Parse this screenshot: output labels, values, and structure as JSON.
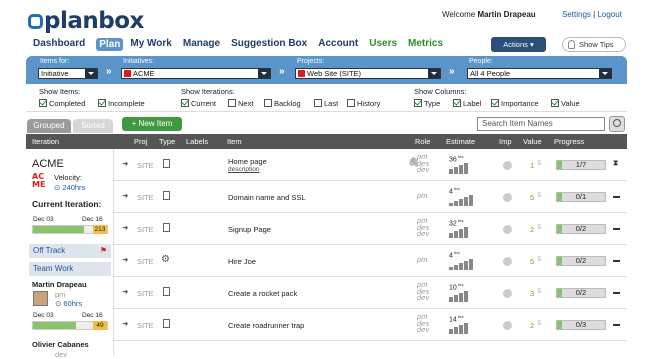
{
  "header": {
    "logo": "planbox",
    "welcome_prefix": "Welcome",
    "user_name": "Martin Drapeau",
    "settings": "Settings",
    "separator": "|",
    "logout": "Logout"
  },
  "nav": {
    "items": [
      "Dashboard",
      "Plan",
      "My Work",
      "Manage",
      "Suggestion Box",
      "Account",
      "Users",
      "Metrics"
    ],
    "active": "Plan",
    "actions": "Actions",
    "show_tips": "Show Tips"
  },
  "filters": {
    "items_for_label": "Items for:",
    "items_for_value": "Initiative",
    "initiatives_label": "Initiatives:",
    "initiatives_value": "ACME",
    "projects_label": "Projects:",
    "projects_value": "Web Site (SITE)",
    "people_label": "People:",
    "people_value": "All 4 People"
  },
  "options": {
    "show_items_label": "Show Items:",
    "show_items": [
      {
        "label": "Completed",
        "checked": true
      },
      {
        "label": "Incomplete",
        "checked": true
      }
    ],
    "show_iterations_label": "Show Iterations:",
    "show_iterations": [
      {
        "label": "Current",
        "checked": true
      },
      {
        "label": "Next",
        "checked": false
      },
      {
        "label": "Backlog",
        "checked": false
      },
      {
        "label": "Last",
        "checked": false
      },
      {
        "label": "History",
        "checked": false
      }
    ],
    "show_columns_label": "Show Columns:",
    "show_columns": [
      {
        "label": "Type",
        "checked": true
      },
      {
        "label": "Label",
        "checked": true
      },
      {
        "label": "Importance",
        "checked": true
      },
      {
        "label": "Value",
        "checked": true
      }
    ]
  },
  "toolbar": {
    "tab_grouped": "Grouped",
    "tab_sorted": "Sorted",
    "new_item": "+ New Item",
    "search_placeholder": "Search Item Names"
  },
  "table_header": {
    "iteration": "Iteration",
    "proj": "Proj",
    "type": "Type",
    "labels": "Labels",
    "item": "Item",
    "role": "Role",
    "estimate": "Estimate",
    "imp": "Imp",
    "value": "Value",
    "progress": "Progress"
  },
  "left": {
    "initiative_name": "ACME",
    "logo_text_1": "AC",
    "logo_text_2": "ME",
    "velocity_label": "Velocity:",
    "velocity_value": "240hrs",
    "current_iteration": "Current Iteration:",
    "iter_start": "Dec 03",
    "iter_end": "Dec 16",
    "iter_hours": "213",
    "iter_progress": 0.82,
    "off_track": "Off Track",
    "team_work": "Team Work",
    "member1_name": "Martin Drapeau",
    "member1_role": "pm",
    "member1_hours": "60hrs",
    "member1_start": "Dec 03",
    "member1_end": "Dec 16",
    "member1_num": "49",
    "member1_progress": 0.7,
    "member2_name": "Olivier Cabanes",
    "member2_role": "dev"
  },
  "rows": [
    {
      "proj": "SITE",
      "item": "Home page",
      "sub": "description",
      "roles": [
        "pm",
        "des",
        "dev"
      ],
      "est": "36",
      "value": "1",
      "progress": "1/7",
      "icon": "doc",
      "end": "hourglass",
      "attach": true
    },
    {
      "proj": "SITE",
      "item": "Domain name and SSL",
      "sub": "",
      "roles": [
        "pm"
      ],
      "est": "4",
      "value": "5",
      "progress": "0/1",
      "icon": "doc",
      "end": "dash",
      "attach": false
    },
    {
      "proj": "SITE",
      "item": "Signup Page",
      "sub": "",
      "roles": [
        "pm",
        "des",
        "dev"
      ],
      "est": "32",
      "value": "2",
      "progress": "0/2",
      "icon": "doc",
      "end": "dash",
      "attach": false
    },
    {
      "proj": "SITE",
      "item": "Hire Joe",
      "sub": "",
      "roles": [
        "pm"
      ],
      "est": "4",
      "value": "5",
      "progress": "0/2",
      "icon": "gear",
      "end": "dash",
      "attach": false
    },
    {
      "proj": "SITE",
      "item": "Create a rocket pack",
      "sub": "",
      "roles": [
        "pm",
        "des",
        "dev"
      ],
      "est": "10",
      "value": "3",
      "progress": "0/2",
      "icon": "doc",
      "end": "dash",
      "attach": false
    },
    {
      "proj": "SITE",
      "item": "Create roadrunner trap",
      "sub": "",
      "roles": [
        "pm",
        "des",
        "dev"
      ],
      "est": "14",
      "value": "2",
      "progress": "0/3",
      "icon": "doc",
      "end": "dash",
      "attach": false
    }
  ],
  "est_unit": "hrs"
}
